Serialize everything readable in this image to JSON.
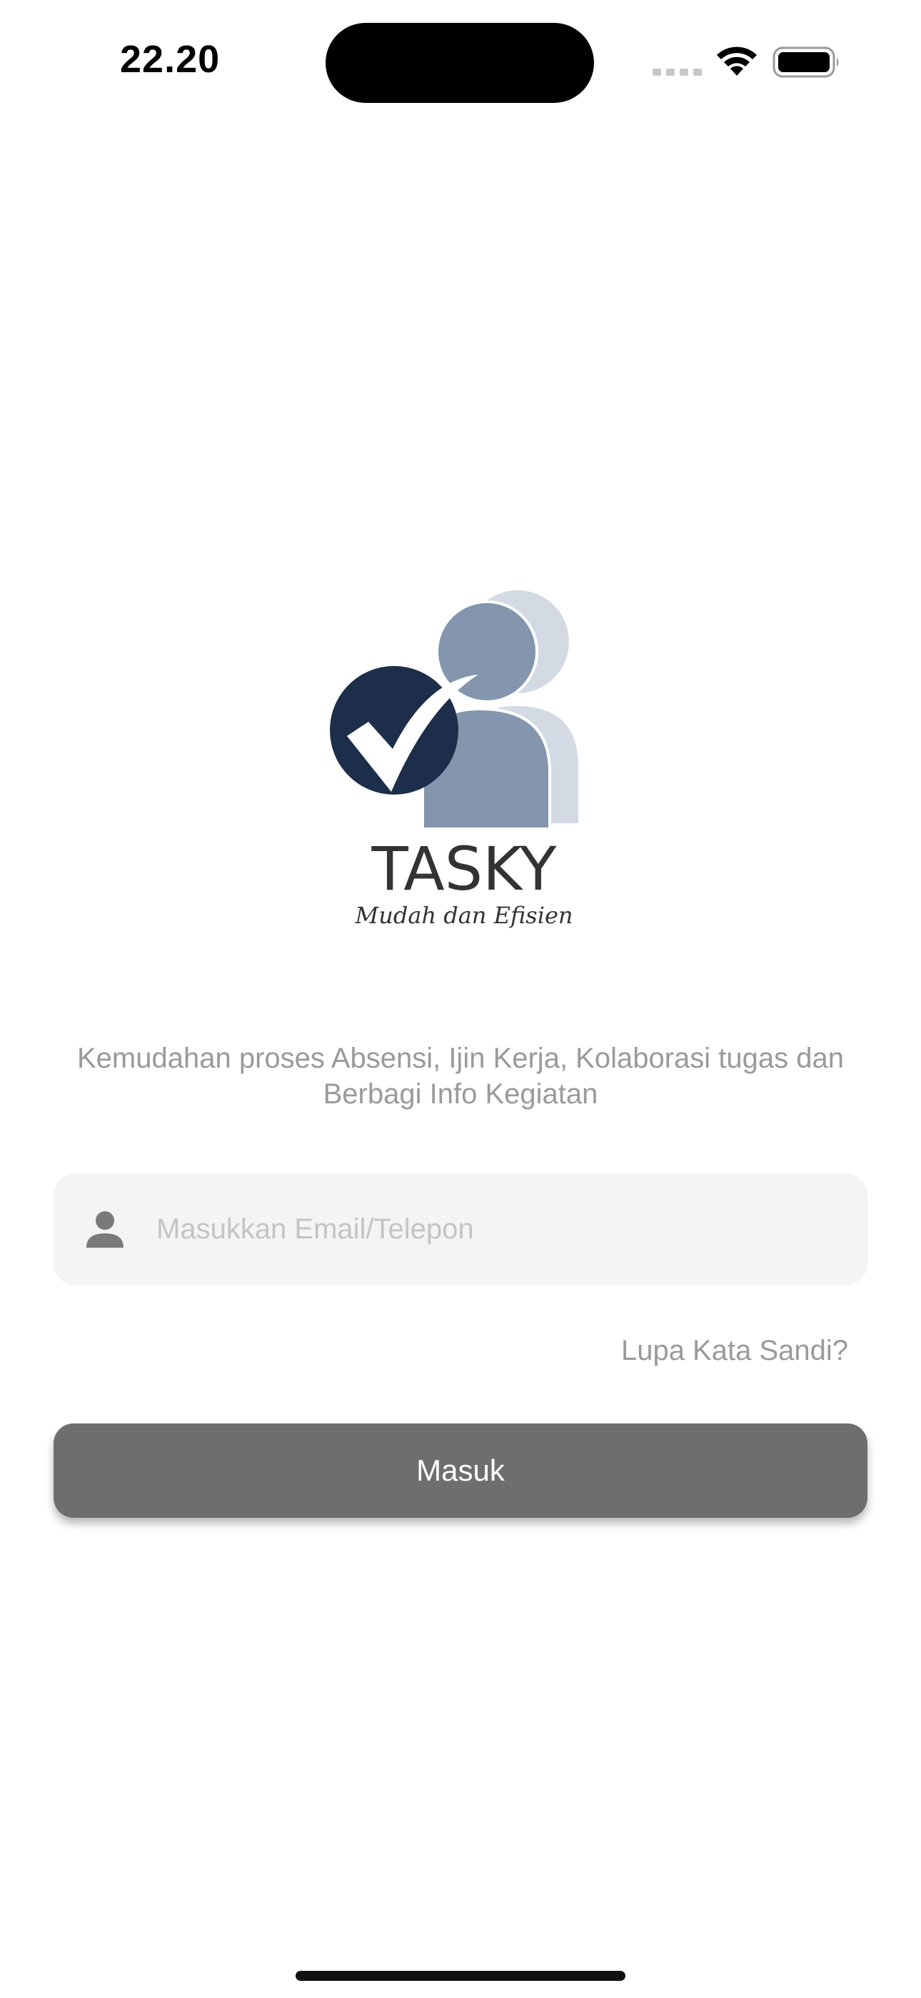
{
  "status_bar": {
    "time": "22.20"
  },
  "logo": {
    "brand": "TASKY",
    "tagline": "Mudah dan Efisien",
    "colors": {
      "check_circle": "#1c2e4a",
      "person_front": "#8496ae",
      "person_back": "#d3dae4"
    }
  },
  "description": "Kemudahan proses Absensi, Ijin Kerja, Kolaborasi tugas dan Berbagi Info Kegiatan",
  "login": {
    "input_icon": "person-icon",
    "input_placeholder": "Masukkan Email/Telepon",
    "input_value": "",
    "forgot_label": "Lupa Kata Sandi?",
    "submit_label": "Masuk"
  },
  "colors": {
    "button_bg": "#6e6e6e",
    "input_bg": "#f4f4f4",
    "muted_text": "#9a9a9a"
  }
}
